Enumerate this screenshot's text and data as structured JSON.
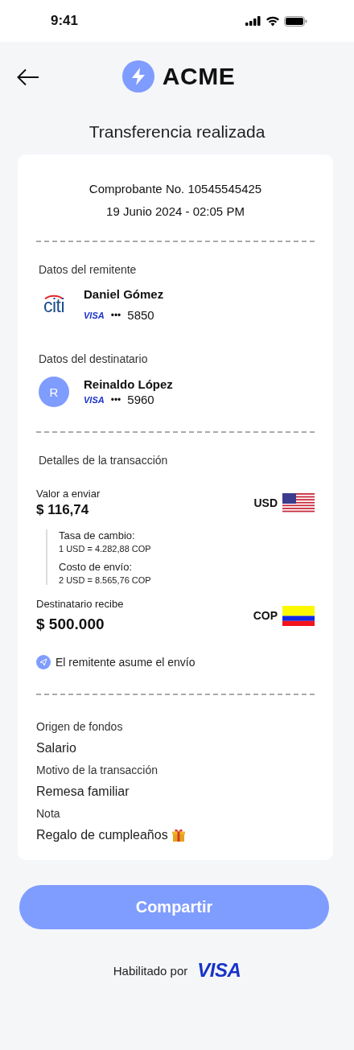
{
  "status_bar": {
    "time": "9:41"
  },
  "header": {
    "brand": "ACME"
  },
  "title": "Transferencia realizada",
  "receipt": {
    "voucher": "Comprobante No. 10545545425",
    "date": "19 Junio 2024 - 02:05 PM",
    "sender": {
      "heading": "Datos del remitente",
      "bank_logo": "citi",
      "name": "Daniel Gómez",
      "card_brand": "VISA",
      "card_mask": "•••",
      "card_last": "5850"
    },
    "recipient": {
      "heading": "Datos del destinatario",
      "avatar": "R",
      "name": "Reinaldo López",
      "card_brand": "VISA",
      "card_mask": "•••",
      "card_last": "5960"
    },
    "details": {
      "heading": "Detalles de la transacción",
      "send_label": "Valor a enviar",
      "send_amount": "$ 116,74",
      "send_currency": "USD",
      "breakdown": [
        {
          "label": "Tasa de cambio:",
          "value": "1 USD = 4.282,88 COP"
        },
        {
          "label": "Costo de envío:",
          "value": "2 USD = 8.565,76 COP"
        }
      ],
      "receive_label": "Destinatario recibe",
      "receive_amount": "$ 500.000",
      "receive_currency": "COP",
      "fee_note": "El remitente asume el envío"
    },
    "extra": [
      {
        "label": "Origen de fondos",
        "value": "Salario",
        "kind": "plain"
      },
      {
        "label": "Motivo de la transacción",
        "value": "Remesa familiar",
        "kind": "plain"
      },
      {
        "label": "Nota",
        "value": "Regalo de cumpleaños",
        "kind": "gift"
      }
    ]
  },
  "share_button": "Compartir",
  "footer": {
    "label": "Habilitado por",
    "brand": "VISA"
  }
}
